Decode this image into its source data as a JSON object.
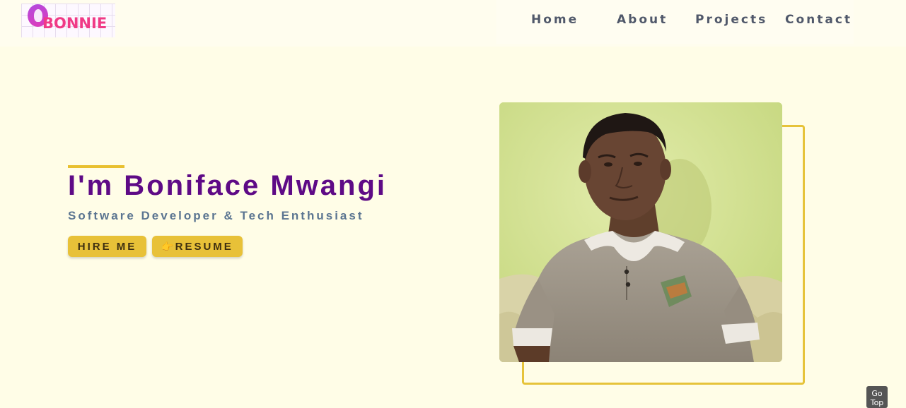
{
  "header": {
    "logo_text": "BONNIE",
    "nav": [
      {
        "label": "Home"
      },
      {
        "label": "About"
      },
      {
        "label": "Projects"
      },
      {
        "label": "Contact"
      }
    ]
  },
  "hero": {
    "title": "I'm Boniface Mwangi",
    "subtitle": "Software Developer & Tech Enthusiast",
    "buttons": {
      "hire_label": "HIRE ME",
      "resume_icon": "👉",
      "resume_label": "RESUME"
    },
    "photo_icon": "profile-photo"
  },
  "go_top_label": "Go Top",
  "colors": {
    "background": "#fffde7",
    "accent": "#e8c138",
    "title": "#5e0a86",
    "subtitle": "#5b7591",
    "nav_text": "#50586a"
  }
}
